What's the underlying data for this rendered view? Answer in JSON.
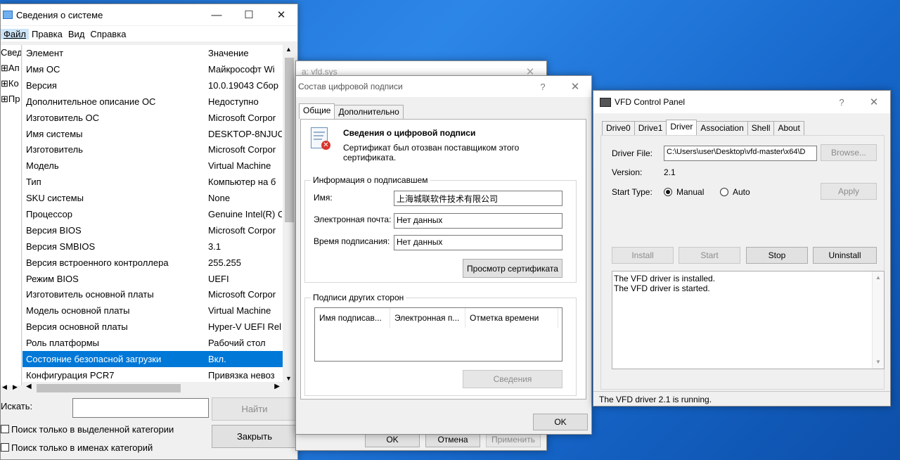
{
  "sysinfo": {
    "title": "Сведения о системе",
    "menu": [
      "Файл",
      "Правка",
      "Вид",
      "Справка"
    ],
    "tree": [
      "Свед",
      "Ап",
      "Ко",
      "Пр"
    ],
    "header": {
      "key": "Элемент",
      "value": "Значение"
    },
    "rows": [
      {
        "k": "Имя ОС",
        "v": "Майкрософт Wi"
      },
      {
        "k": "Версия",
        "v": "10.0.19043 Сбор"
      },
      {
        "k": "Дополнительное описание ОС",
        "v": "Недоступно"
      },
      {
        "k": "Изготовитель ОС",
        "v": "Microsoft Corpor"
      },
      {
        "k": "Имя системы",
        "v": "DESKTOP-8NJUC"
      },
      {
        "k": "Изготовитель",
        "v": "Microsoft Corpor"
      },
      {
        "k": "Модель",
        "v": "Virtual Machine"
      },
      {
        "k": "Тип",
        "v": "Компьютер на б"
      },
      {
        "k": "SKU системы",
        "v": "None"
      },
      {
        "k": "Процессор",
        "v": "Genuine Intel(R) C"
      },
      {
        "k": "Версия BIOS",
        "v": "Microsoft Corpor"
      },
      {
        "k": "Версия SMBIOS",
        "v": "3.1"
      },
      {
        "k": "Версия встроенного контроллера",
        "v": "255.255"
      },
      {
        "k": "Режим BIOS",
        "v": "UEFI"
      },
      {
        "k": "Изготовитель основной платы",
        "v": "Microsoft Corpor"
      },
      {
        "k": "Модель основной платы",
        "v": "Virtual Machine"
      },
      {
        "k": "Версия основной платы",
        "v": "Hyper-V UEFI Rel"
      },
      {
        "k": "Роль платформы",
        "v": "Рабочий стол"
      },
      {
        "k": "Состояние безопасной загрузки",
        "v": "Вкл."
      },
      {
        "k": "Конфигурация PCR7",
        "v": "Привязка невоз"
      }
    ],
    "search_label": "Искать:",
    "find_button": "Найти",
    "close_button": "Закрыть",
    "check_selected": "Поиск только в выделенной категории",
    "check_names": "Поиск только в именах категорий"
  },
  "props": {
    "title": "а: vfd.sys",
    "ok": "OK",
    "cancel": "Отмена",
    "apply": "Применить"
  },
  "sig": {
    "title": "Состав цифровой подписи",
    "help": "?",
    "tab_general": "Общие",
    "tab_advanced": "Дополнительно",
    "heading": "Сведения о цифровой подписи",
    "msg_line1": "Сертификат был отозван поставщиком этого",
    "msg_line2": "сертификата.",
    "signer_group": "Информация о подписавшем",
    "name_label": "Имя:",
    "name_value": "上海城联软件技术有限公司",
    "email_label": "Электронная почта:",
    "email_value": "Нет данных",
    "time_label": "Время подписания:",
    "time_value": "Нет данных",
    "view_cert": "Просмотр сертификата",
    "counter_group": "Подписи других сторон",
    "columns": [
      "Имя подписав...",
      "Электронная п...",
      "Отметка времени"
    ],
    "details": "Сведения",
    "ok": "OK"
  },
  "vfd": {
    "title": "VFD Control Panel",
    "help": "?",
    "tabs": [
      "Drive0",
      "Drive1",
      "Driver",
      "Association",
      "Shell",
      "About"
    ],
    "driver_file_label": "Driver File:",
    "driver_file_value": "C:\\Users\\user\\Desktop\\vfd-master\\x64\\D",
    "browse": "Browse...",
    "version_label": "Version:",
    "version_value": "2.1",
    "start_type_label": "Start Type:",
    "manual": "Manual",
    "auto": "Auto",
    "apply": "Apply",
    "install": "Install",
    "start": "Start",
    "stop": "Stop",
    "uninstall": "Uninstall",
    "log_line1": "The VFD driver is installed.",
    "log_line2": "The VFD driver is started.",
    "status": "The VFD driver 2.1 is running."
  }
}
